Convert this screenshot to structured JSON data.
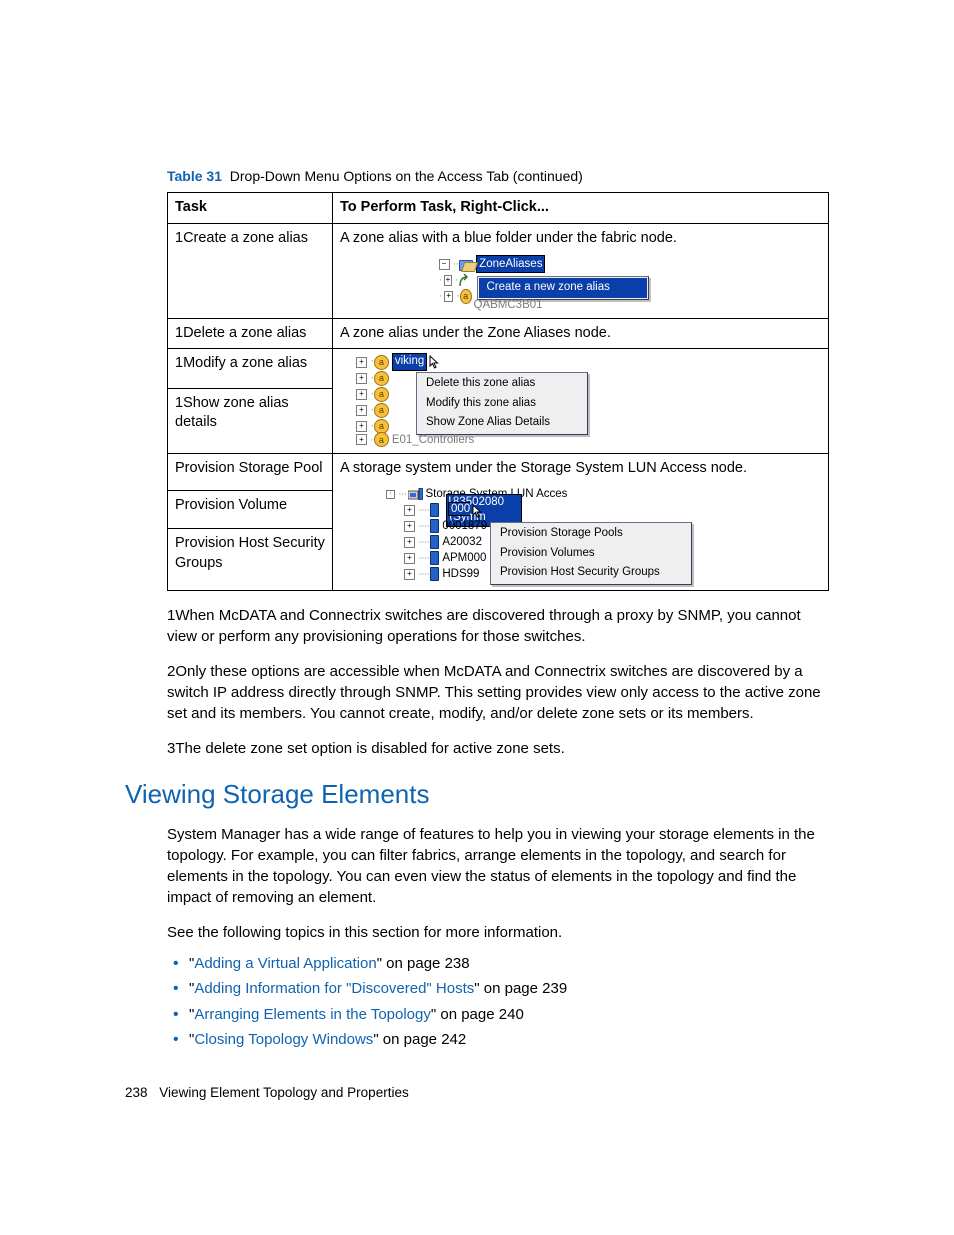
{
  "table_caption": {
    "label": "Table 31",
    "text": "Drop-Down Menu Options on the Access Tab (continued)"
  },
  "table": {
    "headers": {
      "c1": "Task",
      "c2": "To Perform Task, Right-Click..."
    },
    "rows": {
      "r1": {
        "task": "1Create a zone alias",
        "desc": "A zone alias with a blue folder under the fabric node."
      },
      "r2": {
        "task": "1Delete a zone alias",
        "desc": "A zone alias under the Zone Aliases node."
      },
      "r3": {
        "task": "1Modify a zone alias"
      },
      "r4": {
        "task": "1Show zone alias details"
      },
      "r5": {
        "task": "Provision Storage Pool",
        "desc": "A storage system under the Storage System LUN Access node."
      },
      "r6": {
        "task": "Provision Volume"
      },
      "r7": {
        "task": "Provision Host Security Groups"
      }
    }
  },
  "ss1": {
    "tree": {
      "root": "ZoneAliases",
      "child_clipped": "QABMC3B01"
    },
    "menu": {
      "item": "Create a new zone alias"
    }
  },
  "ss2": {
    "sel": "viking",
    "clipped": "E01_Controllers",
    "menu": {
      "i1": "Delete this zone alias",
      "i2": "Modify this zone alias",
      "i3": "Show Zone Alias Details"
    }
  },
  "ss3": {
    "root": "Storage System LUN Acces",
    "sel": "000183502080 (Symm",
    "items": {
      "i1": "0001879",
      "i2": "A20032",
      "i3": "APM000",
      "i4": "HDS99"
    },
    "menu": {
      "i1": "Provision Storage Pools",
      "i2": "Provision Volumes",
      "i3": "Provision Host Security Groups"
    }
  },
  "footnotes": {
    "n1": "1When McDATA and Connectrix switches are discovered through a proxy by SNMP, you cannot view or perform any provisioning operations for those switches.",
    "n2": "2Only these options are accessible when McDATA and Connectrix switches are discovered by a switch IP address directly through SNMP. This setting provides view only access to the active zone set and its members. You cannot create, modify, and/or delete zone sets or its members.",
    "n3": "3The delete zone set option is disabled for active zone sets."
  },
  "section": {
    "heading": "Viewing Storage Elements"
  },
  "body": {
    "p1": "System Manager has a wide range of features to help you in viewing your storage elements in the topology. For example, you can filter fabrics, arrange elements in the topology, and search for elements in the topology. You can even view the status of elements in the topology and find the impact of removing an element.",
    "p2": "See the following topics in this section for more information."
  },
  "links": {
    "l1": {
      "text": "Adding a Virtual Application",
      "suffix": "\" on page 238"
    },
    "l2": {
      "text": "Adding Information for \"Discovered\" Hosts",
      "suffix": "\" on page 239"
    },
    "l3": {
      "text": "Arranging Elements in the Topology",
      "suffix": "\" on page 240"
    },
    "l4": {
      "text": "Closing Topology Windows",
      "suffix": "\" on page 242"
    }
  },
  "footer": {
    "page": "238",
    "title": "Viewing Element Topology and Properties"
  }
}
